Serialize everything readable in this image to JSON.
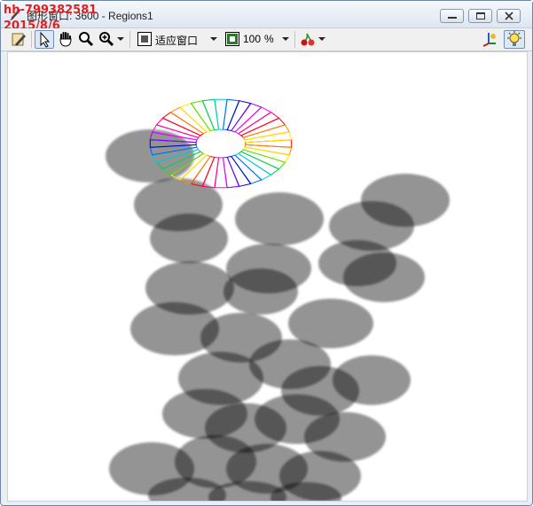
{
  "window": {
    "title": "图形窗口: 3600 - Regions1",
    "watermark_line1": "hh-799382581",
    "watermark_line2": "2015/8/6"
  },
  "toolbar": {
    "zoom_fit_label": "适应窗口",
    "zoom_percent_value": "100",
    "zoom_percent_unit": "%"
  },
  "icons": {
    "app": "app-feather-icon",
    "edit": "pencil-edit-icon",
    "pointer": "pointer-cursor-icon",
    "pan": "hand-pan-icon",
    "magnifier": "magnifier-icon",
    "zoom_in": "zoom-in-icon",
    "fit": "fit-window-icon",
    "zoom": "zoom-percent-icon",
    "color": "color-cherries-icon",
    "axes": "axes-icon",
    "lightbulb": "lightbulb-icon"
  },
  "colors": {
    "spoke_colors": [
      "#ff0000",
      "#ff8800",
      "#ffee00",
      "#44dd00",
      "#00cc66",
      "#00ccdd",
      "#0066ff",
      "#0000cc",
      "#8800ff",
      "#ff00ff",
      "#ff0088"
    ]
  }
}
